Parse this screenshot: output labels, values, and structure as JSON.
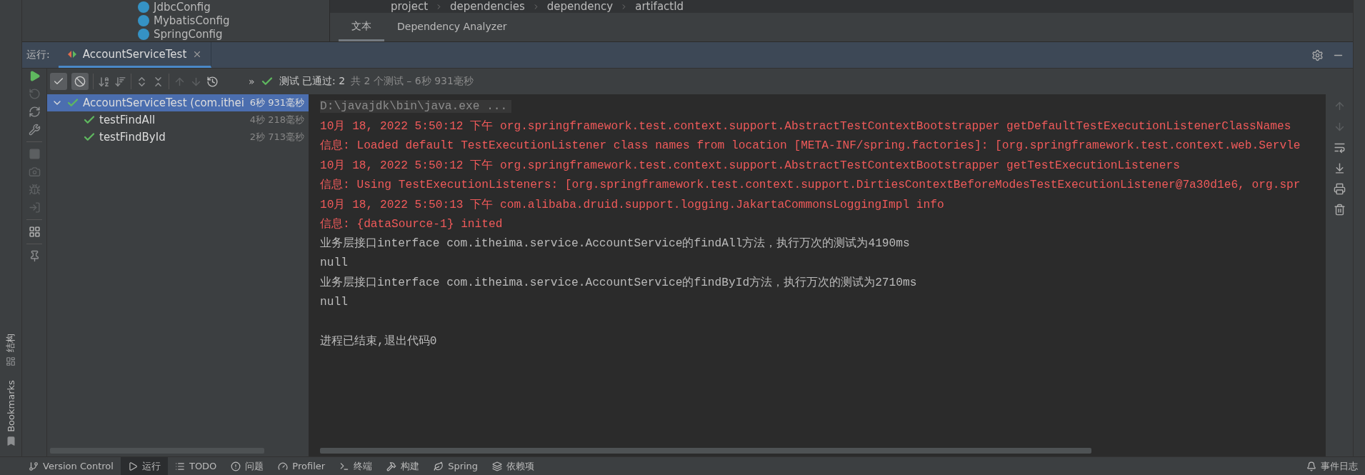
{
  "project_tree": {
    "items": [
      {
        "name": "JdbcConfig"
      },
      {
        "name": "MybatisConfig"
      },
      {
        "name": "SpringConfig"
      }
    ]
  },
  "editor": {
    "breadcrumbs": [
      "project",
      "dependencies",
      "dependency",
      "artifactId"
    ],
    "tabs": [
      {
        "label": "文本",
        "selected": true
      },
      {
        "label": "Dependency Analyzer",
        "selected": false
      }
    ]
  },
  "run_window": {
    "title": "运行:",
    "tabs": [
      {
        "label": "AccountServiceTest",
        "selected": true
      }
    ],
    "filters": [
      {
        "kind": "passed",
        "checked": true
      },
      {
        "kind": "ignored",
        "checked": true
      }
    ],
    "status": {
      "more": "»",
      "passed": "测试 已通过: 2",
      "detail": "共 2 个测试 – 6秒 931毫秒"
    },
    "test_tree": [
      {
        "name": "AccountServiceTest (com.ithei",
        "time": "6秒 931毫秒",
        "selected": true,
        "expanded": true,
        "children": [
          {
            "name": "testFindAll",
            "time": "4秒 218毫秒",
            "selected": false
          },
          {
            "name": "testFindById",
            "time": "2秒 713毫秒",
            "selected": false
          }
        ]
      }
    ],
    "console": [
      {
        "kind": "command",
        "text": "D:\\javajdk\\bin\\java.exe ..."
      },
      {
        "kind": "log",
        "text": "10月 18, 2022 5:50:12 下午 org.springframework.test.context.support.AbstractTestContextBootstrapper getDefaultTestExecutionListenerClassNames"
      },
      {
        "kind": "log",
        "text": "信息: Loaded default TestExecutionListener class names from location [META-INF/spring.factories]: [org.springframework.test.context.web.Servle"
      },
      {
        "kind": "log",
        "text": "10月 18, 2022 5:50:12 下午 org.springframework.test.context.support.AbstractTestContextBootstrapper getTestExecutionListeners"
      },
      {
        "kind": "log",
        "text": "信息: Using TestExecutionListeners: [org.springframework.test.context.support.DirtiesContextBeforeModesTestExecutionListener@7a30d1e6, org.spr"
      },
      {
        "kind": "log",
        "text": "10月 18, 2022 5:50:13 下午 com.alibaba.druid.support.logging.JakartaCommonsLoggingImpl info"
      },
      {
        "kind": "log",
        "text": "信息: {dataSource-1} inited"
      },
      {
        "kind": "output",
        "text": "业务层接口interface com.itheima.service.AccountService的findAll方法，执行万次的测试为4190ms"
      },
      {
        "kind": "output",
        "text": "null"
      },
      {
        "kind": "output",
        "text": "业务层接口interface com.itheima.service.AccountService的findById方法，执行万次的测试为2710ms"
      },
      {
        "kind": "output",
        "text": "null"
      },
      {
        "kind": "blank"
      },
      {
        "kind": "output",
        "text": "进程已结束,退出代码0"
      }
    ]
  },
  "left_stripe": [
    {
      "label": "结构",
      "kind": "structure"
    },
    {
      "label": "Bookmarks",
      "kind": "bookmarks"
    }
  ],
  "status_bar": {
    "items": [
      {
        "label": "Version Control",
        "kind": "vcs",
        "selected": false
      },
      {
        "label": "运行",
        "kind": "run",
        "selected": true
      },
      {
        "label": "TODO",
        "kind": "todo",
        "selected": false
      },
      {
        "label": "问题",
        "kind": "problems",
        "selected": false
      },
      {
        "label": "Profiler",
        "kind": "profiler",
        "selected": false
      },
      {
        "label": "终端",
        "kind": "terminal",
        "selected": false
      },
      {
        "label": "构建",
        "kind": "build",
        "selected": false
      },
      {
        "label": "Spring",
        "kind": "spring",
        "selected": false
      },
      {
        "label": "依赖项",
        "kind": "deps",
        "selected": false
      }
    ],
    "right": {
      "label": "事件日志",
      "kind": "events"
    }
  }
}
